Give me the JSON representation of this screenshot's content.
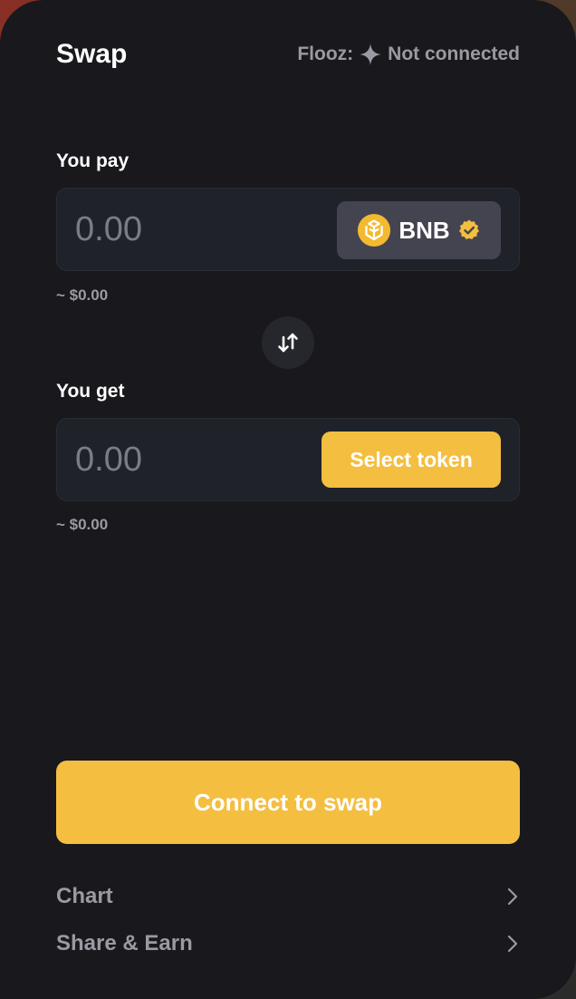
{
  "header": {
    "title": "Swap",
    "status_prefix": "Flooz:",
    "status_text": "Not connected",
    "status_icon": "sparkle-icon"
  },
  "pay": {
    "label": "You pay",
    "amount_placeholder": "0.00",
    "token_symbol": "BNB",
    "token_logo": "bnb-logo",
    "token_badge": "verified-badge-icon",
    "usd_value": "~ $0.00"
  },
  "swap_toggle": {
    "icon": "swap-arrows-icon"
  },
  "get": {
    "label": "You get",
    "amount_placeholder": "0.00",
    "select_label": "Select token",
    "usd_value": "~ $0.00"
  },
  "connect_label": "Connect to swap",
  "menu": [
    {
      "label": "Chart",
      "icon": "chevron-right-icon"
    },
    {
      "label": "Share & Earn",
      "icon": "chevron-right-icon"
    }
  ],
  "colors": {
    "card_bg": "#18181d",
    "box_bg": "#202229",
    "accent": "#f4be40",
    "token_button_bg": "#444451",
    "muted_text": "#9a9aa2",
    "placeholder_text": "#7b7d86"
  }
}
